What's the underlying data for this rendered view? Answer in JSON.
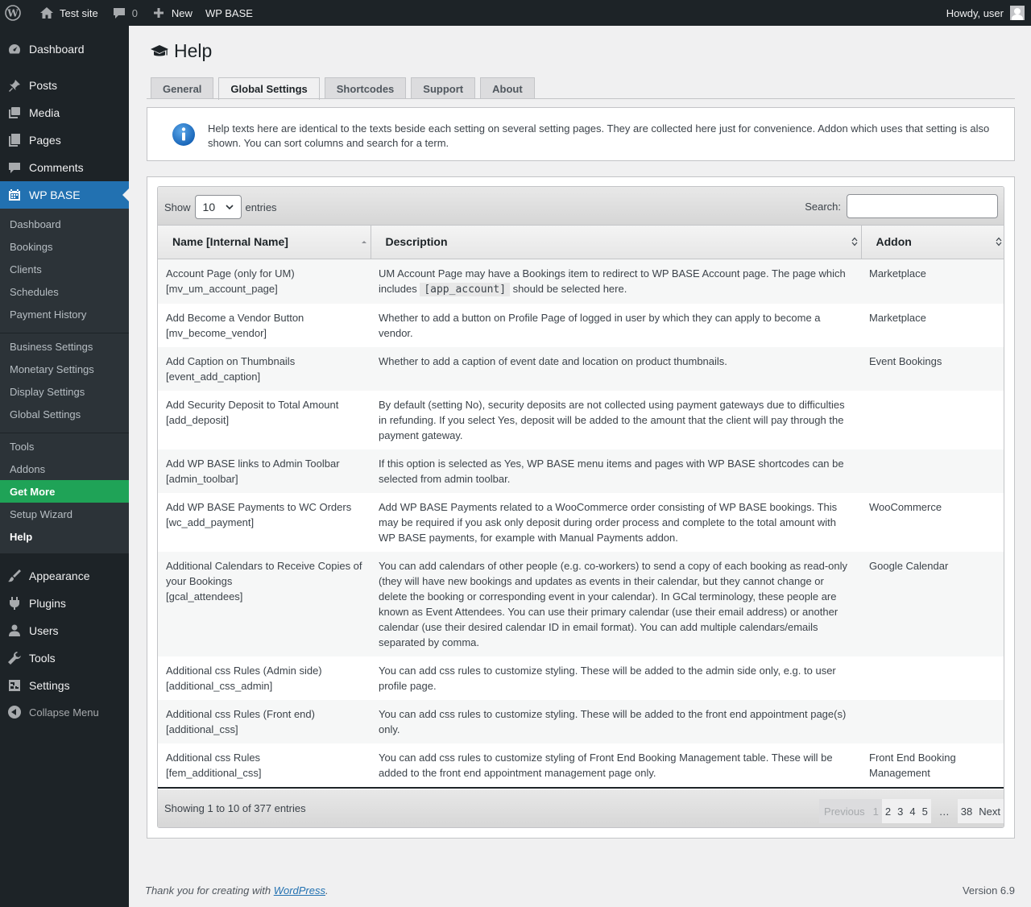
{
  "adminbar": {
    "site_name": "Test site",
    "comments_count": "0",
    "new_label": "New",
    "plugin_label": "WP BASE",
    "howdy": "Howdy, user"
  },
  "sidebar": {
    "top": [
      {
        "label": "Dashboard",
        "icon": "dashboard-icon"
      },
      {
        "label": "Posts",
        "icon": "pin-icon"
      },
      {
        "label": "Media",
        "icon": "media-icon"
      },
      {
        "label": "Pages",
        "icon": "page-icon"
      },
      {
        "label": "Comments",
        "icon": "comment-icon"
      },
      {
        "label": "WP BASE",
        "icon": "calendar-icon"
      }
    ],
    "submenu": [
      "Dashboard",
      "Bookings",
      "Clients",
      "Schedules",
      "Payment History",
      "Business Settings",
      "Monetary Settings",
      "Display Settings",
      "Global Settings",
      "Tools",
      "Addons",
      "Get More",
      "Setup Wizard",
      "Help"
    ],
    "bottom": [
      {
        "label": "Appearance",
        "icon": "brush-icon"
      },
      {
        "label": "Plugins",
        "icon": "plugin-icon"
      },
      {
        "label": "Users",
        "icon": "users-icon"
      },
      {
        "label": "Tools",
        "icon": "wrench-icon"
      },
      {
        "label": "Settings",
        "icon": "settings-icon"
      }
    ],
    "collapse": "Collapse Menu"
  },
  "page": {
    "title": "Help",
    "tabs": [
      "General",
      "Global Settings",
      "Shortcodes",
      "Support",
      "About"
    ],
    "active_tab": "Global Settings",
    "notice": "Help texts here are identical to the texts beside each setting on several setting pages. They are collected here just for convenience. Addon which uses that setting is also shown. You can sort columns and search for a term."
  },
  "table": {
    "show_label": "Show",
    "entries_value": "10",
    "entries_label": "entries",
    "search_label": "Search:",
    "search_value": "",
    "columns": [
      "Name [Internal Name]",
      "Description",
      "Addon"
    ],
    "rows": [
      {
        "name": "Account Page (only for UM)",
        "key": "[mv_um_account_page]",
        "desc_pre": "UM Account Page may have a Bookings item to redirect to WP BASE Account page. The page which includes ",
        "desc_code": "[app_account]",
        "desc_post": " should be selected here.",
        "addon": "Marketplace"
      },
      {
        "name": "Add Become a Vendor Button",
        "key": "[mv_become_vendor]",
        "desc_pre": "Whether to add a button on Profile Page of logged in user by which they can apply to become a vendor.",
        "desc_code": "",
        "desc_post": "",
        "addon": "Marketplace"
      },
      {
        "name": "Add Caption on Thumbnails",
        "key": "[event_add_caption]",
        "desc_pre": "Whether to add a caption of event date and location on product thumbnails.",
        "desc_code": "",
        "desc_post": "",
        "addon": "Event Bookings"
      },
      {
        "name": "Add Security Deposit to Total Amount",
        "key": "[add_deposit]",
        "desc_pre": "By default (setting No), security deposits are not collected using payment gateways due to difficulties in refunding. If you select Yes, deposit will be added to the amount that the client will pay through the payment gateway.",
        "desc_code": "",
        "desc_post": "",
        "addon": ""
      },
      {
        "name": "Add WP BASE links to Admin Toolbar",
        "key": "[admin_toolbar]",
        "desc_pre": "If this option is selected as Yes, WP BASE menu items and pages with WP BASE shortcodes can be selected from admin toolbar.",
        "desc_code": "",
        "desc_post": "",
        "addon": ""
      },
      {
        "name": "Add WP BASE Payments to WC Orders",
        "key": "[wc_add_payment]",
        "desc_pre": "Add WP BASE Payments related to a WooCommerce order consisting of WP BASE bookings. This may be required if you ask only deposit during order process and complete to the total amount with WP BASE payments, for example with Manual Payments addon.",
        "desc_code": "",
        "desc_post": "",
        "addon": "WooCommerce"
      },
      {
        "name": "Additional Calendars to Receive Copies of your Bookings",
        "key": "[gcal_attendees]",
        "desc_pre": "You can add calendars of other people (e.g. co-workers) to send a copy of each booking as read-only (they will have new bookings and updates as events in their calendar, but they cannot change or delete the booking or corresponding event in your calendar). In GCal terminology, these people are known as Event Attendees. You can use their primary calendar (use their email address) or another calendar (use their desired calendar ID in email format). You can add multiple calendars/emails separated by comma.",
        "desc_code": "",
        "desc_post": "",
        "addon": "Google Calendar"
      },
      {
        "name": "Additional css Rules (Admin side)",
        "key": "[additional_css_admin]",
        "desc_pre": "You can add css rules to customize styling. These will be added to the admin side only, e.g. to user profile page.",
        "desc_code": "",
        "desc_post": "",
        "addon": ""
      },
      {
        "name": "Additional css Rules (Front end)",
        "key": "[additional_css]",
        "desc_pre": "You can add css rules to customize styling. These will be added to the front end appointment page(s) only.",
        "desc_code": "",
        "desc_post": "",
        "addon": ""
      },
      {
        "name": "Additional css Rules",
        "key": "[fem_additional_css]",
        "desc_pre": "You can add css rules to customize styling of Front End Booking Management table. These will be added to the front end appointment management page only.",
        "desc_code": "",
        "desc_post": "",
        "addon": "Front End Booking Management"
      }
    ],
    "info": "Showing 1 to 10 of 377 entries",
    "pager": {
      "previous": "Previous",
      "pages": [
        "1",
        "2",
        "3",
        "4",
        "5"
      ],
      "ellipsis": "…",
      "last": "38",
      "next": "Next"
    }
  },
  "footer": {
    "thanks_pre": "Thank you for creating with ",
    "thanks_link": "WordPress",
    "thanks_post": ".",
    "version": "Version 6.9"
  },
  "colors": {
    "adminbar_bg": "#1d2327",
    "menu_current": "#2271b1",
    "get_more": "#1fa357",
    "link": "#2271b1"
  }
}
